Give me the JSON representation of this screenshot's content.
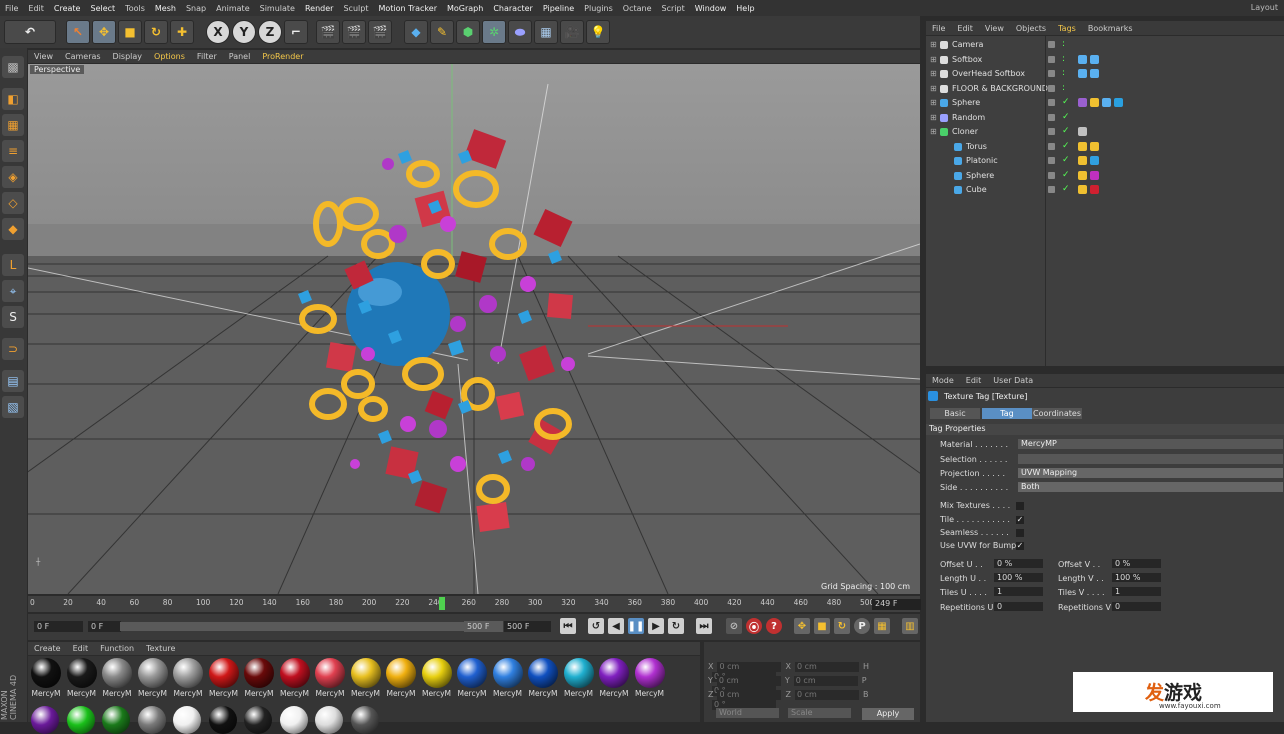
{
  "menubar": {
    "items": [
      "File",
      "Edit",
      "Create",
      "Select",
      "Tools",
      "Mesh",
      "Snap",
      "Animate",
      "Simulate",
      "Render",
      "Sculpt",
      "Motion Tracker",
      "MoGraph",
      "Character",
      "Pipeline",
      "Plugins",
      "Octane",
      "Script",
      "Window",
      "Help"
    ],
    "layout_label": "Layout"
  },
  "toolbar": {
    "axis_x": "X",
    "axis_y": "Y",
    "axis_z": "Z"
  },
  "viewport": {
    "menu": [
      "View",
      "Cameras",
      "Display",
      "Options",
      "Filter",
      "Panel",
      "ProRender"
    ],
    "camera_label": "Perspective",
    "grid_spacing": "Grid Spacing : 100 cm"
  },
  "timeline": {
    "ticks": [
      "0",
      "20",
      "40",
      "60",
      "80",
      "100",
      "120",
      "140",
      "160",
      "180",
      "200",
      "220",
      "240",
      "260",
      "280",
      "300",
      "320",
      "340",
      "360",
      "380",
      "400",
      "420",
      "440",
      "460",
      "480",
      "500"
    ],
    "current_frame": "249 F",
    "playhead_frame": 244
  },
  "transport": {
    "start_frame": "0 F",
    "range_start": "0 F",
    "range_end": "500 F",
    "end_frame": "500 F"
  },
  "material_manager": {
    "menu": [
      "Create",
      "Edit",
      "Function",
      "Texture"
    ],
    "materials": [
      {
        "name": "MercyM",
        "color": "#111111"
      },
      {
        "name": "MercyM",
        "color": "#1a1a1a"
      },
      {
        "name": "MercyM",
        "color": "#8a8a8a"
      },
      {
        "name": "MercyM",
        "color": "#9a9a9a"
      },
      {
        "name": "MercyM",
        "color": "#a0a0a0"
      },
      {
        "name": "MercyM",
        "color": "#d01818"
      },
      {
        "name": "MercyM",
        "color": "#6a0a0a"
      },
      {
        "name": "MercyM",
        "color": "#c01020"
      },
      {
        "name": "MercyM",
        "color": "#e04050"
      },
      {
        "name": "MercyM",
        "color": "#e8c020"
      },
      {
        "name": "MercyM",
        "color": "#f0b010"
      },
      {
        "name": "MercyM",
        "color": "#e8d010"
      },
      {
        "name": "MercyM",
        "color": "#2060d0"
      },
      {
        "name": "MercyM",
        "color": "#3080e0"
      },
      {
        "name": "MercyM",
        "color": "#1050c0"
      },
      {
        "name": "MercyM",
        "color": "#20b0d0"
      },
      {
        "name": "MercyM",
        "color": "#8020c0"
      },
      {
        "name": "MercyM",
        "color": "#b030d0"
      }
    ],
    "brand": "MAXON CINEMA 4D"
  },
  "coordinates": {
    "rows": [
      {
        "a": "X",
        "av": "0 cm",
        "b": "X",
        "bv": "0 cm",
        "c": "H",
        "cv": "0 °"
      },
      {
        "a": "Y",
        "av": "0 cm",
        "b": "Y",
        "bv": "0 cm",
        "c": "P",
        "cv": "0 °"
      },
      {
        "a": "Z",
        "av": "0 cm",
        "b": "Z",
        "bv": "0 cm",
        "c": "B",
        "cv": "0 °"
      }
    ],
    "mode": "World",
    "scale": "Scale",
    "apply": "Apply"
  },
  "object_manager": {
    "menu": [
      "File",
      "Edit",
      "View",
      "Objects",
      "Tags",
      "Bookmarks"
    ],
    "objects": [
      {
        "name": "Camera",
        "indent": 0,
        "icon": "#dddddd"
      },
      {
        "name": "Softbox",
        "indent": 0,
        "icon": "#dddddd"
      },
      {
        "name": "OverHead Softbox",
        "indent": 0,
        "icon": "#dddddd"
      },
      {
        "name": "FLOOR & BACKGROUND",
        "indent": 0,
        "icon": "#dddddd"
      },
      {
        "name": "Sphere",
        "indent": 0,
        "icon": "#4aa8e8"
      },
      {
        "name": "Random",
        "indent": 0,
        "icon": "#9aa0ff"
      },
      {
        "name": "Cloner",
        "indent": 0,
        "icon": "#4ad06a"
      },
      {
        "name": "Torus",
        "indent": 1,
        "icon": "#4aa8e8"
      },
      {
        "name": "Platonic",
        "indent": 1,
        "icon": "#4aa8e8"
      },
      {
        "name": "Sphere",
        "indent": 1,
        "icon": "#4aa8e8"
      },
      {
        "name": "Cube",
        "indent": 1,
        "icon": "#4aa8e8"
      }
    ]
  },
  "attribute_manager": {
    "menu": [
      "Mode",
      "Edit",
      "User Data"
    ],
    "title": "Texture Tag [Texture]",
    "tabs": [
      "Basic",
      "Tag",
      "Coordinates"
    ],
    "section": "Tag Properties",
    "material_label": "Material . . . . . . .",
    "material_value": "MercyMP",
    "selection_label": "Selection . . . . . .",
    "projection_label": "Projection . . . . .",
    "projection_value": "UVW Mapping",
    "side_label": "Side . . . . . . . . . .",
    "side_value": "Both",
    "mix_label": "Mix Textures . . . .",
    "tile_label": "Tile . . . . . . . . . . .",
    "seamless_label": "Seamless . . . . . .",
    "uvw_label": "Use UVW for Bump",
    "offset_u_label": "Offset U . .",
    "offset_u": "0 %",
    "offset_v_label": "Offset V . .",
    "offset_v": "0 %",
    "length_u_label": "Length U . .",
    "length_u": "100 %",
    "length_v_label": "Length V . .",
    "length_v": "100 %",
    "tiles_u_label": "Tiles U . . . .",
    "tiles_u": "1",
    "tiles_v_label": "Tiles V . . . .",
    "tiles_v": "1",
    "rep_u_label": "Repetitions U",
    "rep_u": "0",
    "rep_v_label": "Repetitions V",
    "rep_v": "0"
  },
  "watermark": {
    "logo_main": "发",
    "logo_rest": "游戏",
    "url": "www.fayouxi.com"
  }
}
